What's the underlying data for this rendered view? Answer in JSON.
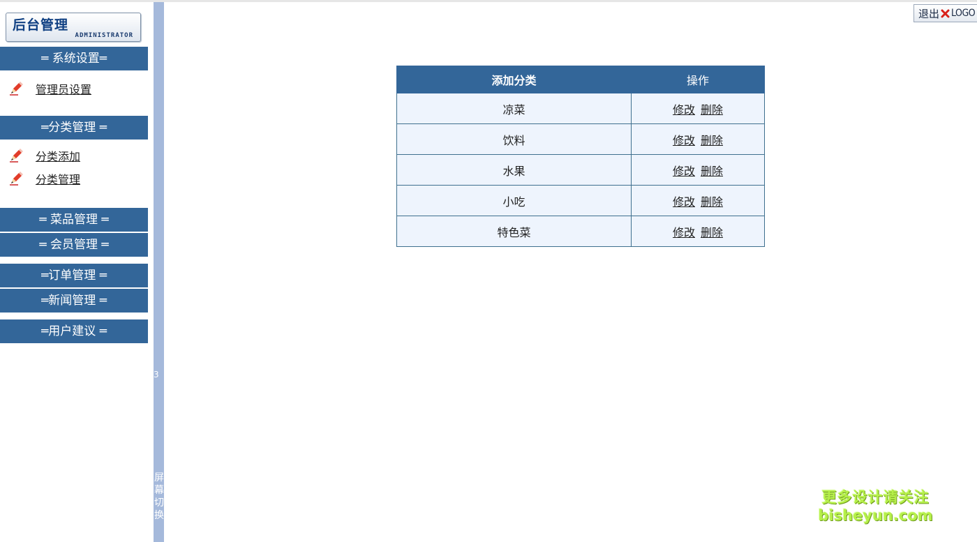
{
  "brand": {
    "title_cn": "后台管理",
    "title_en": "ADMINISTRATOR"
  },
  "sidebar": {
    "sections": [
      {
        "label": "═ 系统设置═"
      },
      {
        "label": "═分类管理 ═"
      },
      {
        "label": "═ 菜品管理 ═"
      },
      {
        "label": "═ 会员管理 ═"
      },
      {
        "label": "═订单管理 ═"
      },
      {
        "label": "═新闻管理 ═"
      },
      {
        "label": "═用户建议 ═"
      }
    ],
    "links": [
      {
        "label": "管理员设置",
        "icon": "pencil-icon"
      },
      {
        "label": "分类添加",
        "icon": "pencil-icon"
      },
      {
        "label": "分类管理",
        "icon": "pencil-icon"
      }
    ]
  },
  "splitter": {
    "number": "3",
    "label": "屏幕切换"
  },
  "topbar": {
    "logout_label": "退出",
    "logo_label": "LOGO",
    "icon": "close-icon"
  },
  "table": {
    "headers": [
      "添加分类",
      "操作"
    ],
    "rows": [
      {
        "name": "凉菜",
        "edit": "修改",
        "delete": "删除"
      },
      {
        "name": "饮料",
        "edit": "修改",
        "delete": "删除"
      },
      {
        "name": "水果",
        "edit": "修改",
        "delete": "删除"
      },
      {
        "name": "小吃",
        "edit": "修改",
        "delete": "删除"
      },
      {
        "name": "特色菜",
        "edit": "修改",
        "delete": "删除"
      }
    ]
  },
  "watermark": {
    "line1": "更多设计请关注",
    "line2": "bisheyun.com"
  },
  "colors": {
    "header_blue": "#336699",
    "row_bg": "#eef4fd",
    "splitter": "#a5b9db"
  }
}
